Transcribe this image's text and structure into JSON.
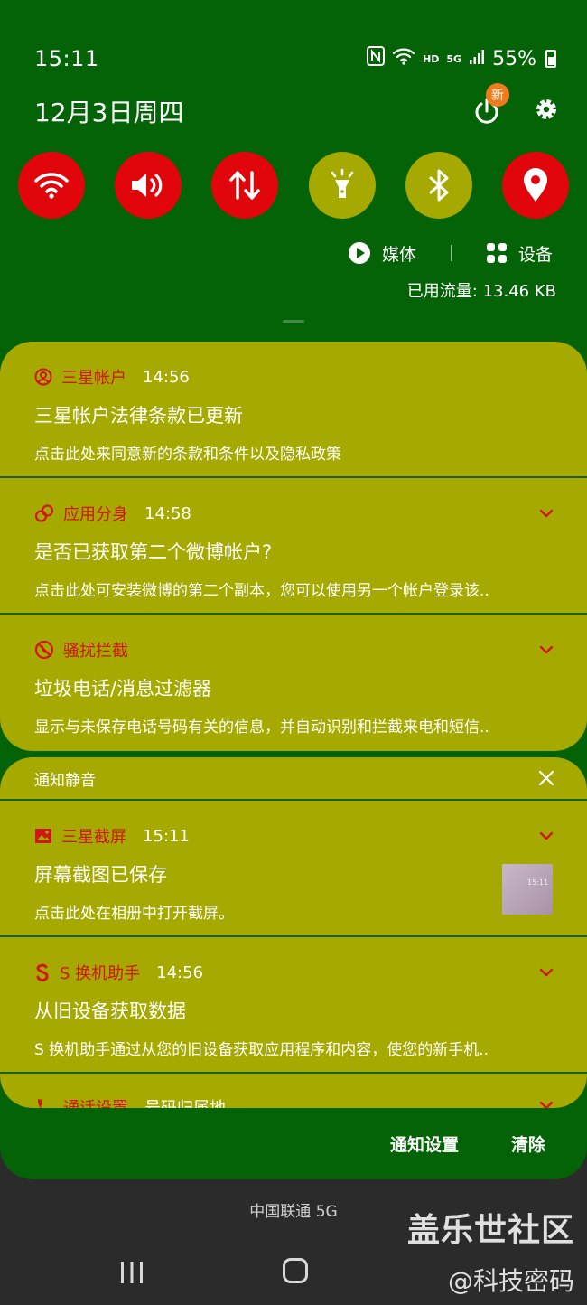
{
  "status_bar": {
    "time": "15:11",
    "nfc": "N",
    "hd": "HD",
    "network": "5G",
    "battery": "55%"
  },
  "header": {
    "date": "12月3日周四",
    "power_badge": "新"
  },
  "quick_settings": [
    {
      "name": "wifi-icon",
      "state": "on"
    },
    {
      "name": "sound-icon",
      "state": "on"
    },
    {
      "name": "mobile-data-icon",
      "state": "on"
    },
    {
      "name": "flashlight-icon",
      "state": "off"
    },
    {
      "name": "bluetooth-icon",
      "state": "off"
    },
    {
      "name": "location-icon",
      "state": "on"
    }
  ],
  "media_row": {
    "media_label": "媒体",
    "devices_label": "设备"
  },
  "data_usage": "已用流量: 13.46 KB",
  "notifications": [
    {
      "app": "三星帐户",
      "time": "14:56",
      "title": "三星帐户法律条款已更新",
      "text": "点击此处来同意新的条款和条件以及隐私政策"
    },
    {
      "app": "应用分身",
      "time": "14:58",
      "title": "是否已获取第二个微博帐户?",
      "text": "点击此处可安装微博的第二个副本，您可以使用另一个帐户登录该.."
    },
    {
      "app": "骚扰拦截",
      "time": "",
      "title": "垃圾电话/消息过滤器",
      "text": "显示与未保存电话号码有关的信息，并自动识别和拦截来电和短信.."
    }
  ],
  "silent_section": {
    "label": "通知静音"
  },
  "silent_notifications": [
    {
      "app": "三星截屏",
      "time": "15:11",
      "title": "屏幕截图已保存",
      "text": "点击此处在相册中打开截屏。"
    },
    {
      "app": "S 换机助手",
      "time": "14:56",
      "title": "从旧设备获取数据",
      "text": "S 换机助手通过从您的旧设备获取应用程序和内容，使您的新手机.."
    },
    {
      "app": "通话设置",
      "time": "号码归属地",
      "title": "",
      "text": ""
    }
  ],
  "footer": {
    "settings_label": "通知设置",
    "clear_label": "清除"
  },
  "carrier": "中国联通 5G",
  "watermark": {
    "line1": "盖乐世社区",
    "line2": "@科技密码"
  },
  "colors": {
    "shade_bg": "#056307",
    "card_bg": "#a5a900",
    "active_tile": "#e0060c",
    "inactive_tile": "#a5a900",
    "app_name": "#d21515"
  }
}
